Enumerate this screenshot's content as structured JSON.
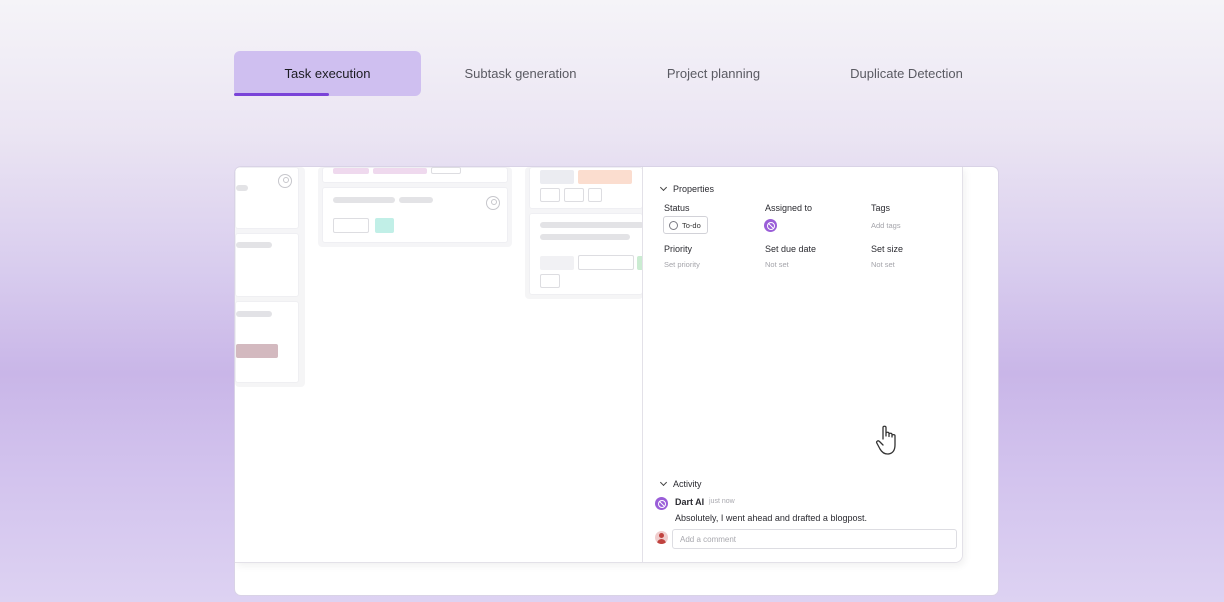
{
  "tabs": [
    {
      "label": "Task execution",
      "active": true,
      "progress": 0.51
    },
    {
      "label": "Subtask generation",
      "active": false
    },
    {
      "label": "Project planning",
      "active": false
    },
    {
      "label": "Duplicate Detection",
      "active": false
    }
  ],
  "panel": {
    "properties_heading": "Properties",
    "status_label": "Status",
    "status_value": "To-do",
    "assigned_label": "Assigned to",
    "tags_label": "Tags",
    "tags_placeholder": "Add tags",
    "priority_label": "Priority",
    "priority_placeholder": "Set priority",
    "due_label": "Set due date",
    "due_value": "Not set",
    "size_label": "Set size",
    "size_value": "Not set",
    "activity_heading": "Activity",
    "comment": {
      "author": "Dart AI",
      "time": "just now",
      "text": "Absolutely, I went ahead and drafted a blogpost."
    },
    "comment_placeholder": "Add a comment"
  },
  "colors": {
    "accent": "#7a43d8",
    "active_tab_bg": "#cfbff0",
    "ai_avatar": "#9a5ed8"
  }
}
